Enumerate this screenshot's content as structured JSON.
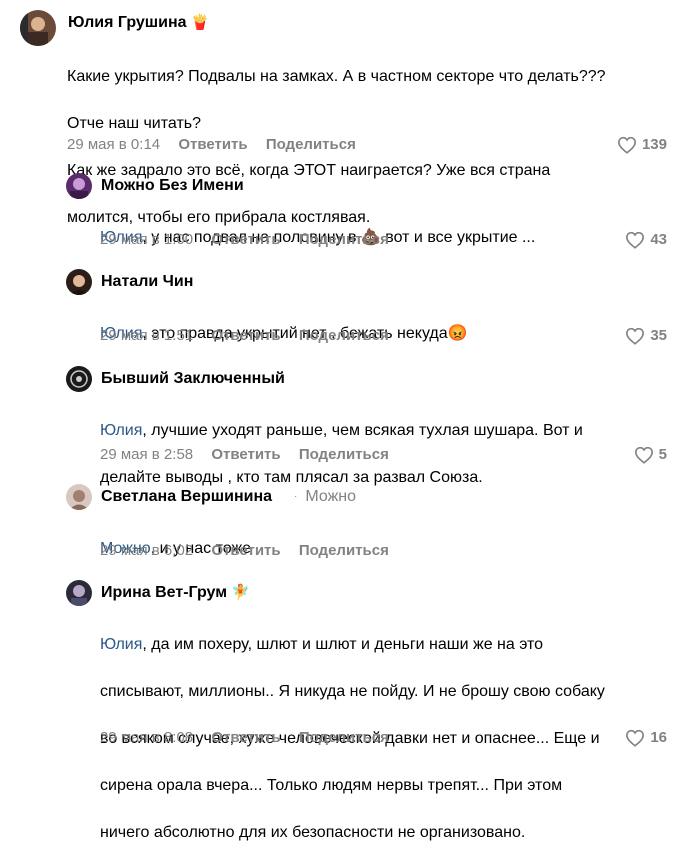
{
  "comments": [
    {
      "author": "Юлия Грушина",
      "author_emoji": "🍟",
      "text_lines": [
        "Какие укрытия? Подвалы на замках. А в частном секторе что делать???",
        "Отче наш читать?",
        "Как же задрало это всё, когда ЭТОТ наиграется? Уже вся страна",
        "молится, чтобы его прибрала костлявая."
      ],
      "date": "29 мая в 0:14",
      "reply_label": "Ответить",
      "share_label": "Поделиться",
      "likes": "139"
    },
    {
      "author": "Можно Без Имени",
      "mention": "Юлия",
      "text": ", у нас подвал на половину в 💩 вот и все укрытие ...",
      "date": "29 мая в 1:00",
      "reply_label": "Ответить",
      "share_label": "Поделиться",
      "likes": "43"
    },
    {
      "author": "Натали Чин",
      "mention": "Юлия",
      "text": ", это правда укрытий нет , бежать некуда😡",
      "date": "29 мая в 1:51",
      "reply_label": "Ответить",
      "share_label": "Поделиться",
      "likes": "35"
    },
    {
      "author": "Бывший Заключенный",
      "mention": "Юлия",
      "text": ", лучшие уходят раньше, чем всякая тухлая шушара. Вот и",
      "text2": "делайте выводы , кто там плясал за развал Союза.",
      "date": "29 мая в 2:58",
      "reply_label": "Ответить",
      "share_label": "Поделиться",
      "likes": "5"
    },
    {
      "author": "Светлана Вершинина",
      "reply_to": "Можно",
      "mention": "Можно",
      "text": ", и у нас тоже",
      "date": "29 мая в 6:02",
      "reply_label": "Ответить",
      "share_label": "Поделиться"
    },
    {
      "author": "Ирина Вет-Грум",
      "author_emoji": "🧚",
      "mention": "Юлия",
      "text": ", да им похеру, шлют и шлют и деньги наши же на это",
      "text_lines": [
        "списывают, миллионы.. Я никуда не пойду. И не брошу свою собаку",
        "во всяком случае, хуже человеческой давки нет и опаснее... Еще и",
        "сирена орала вчера... Только людям нервы трепят... При этом",
        "ничего абсолютно для их безопасности не организовано."
      ],
      "date": "29 мая в 8:08",
      "reply_label": "Ответить",
      "share_label": "Поделиться",
      "likes": "16"
    }
  ],
  "colors": {
    "mention": "#2a5885",
    "meta": "#828282"
  }
}
